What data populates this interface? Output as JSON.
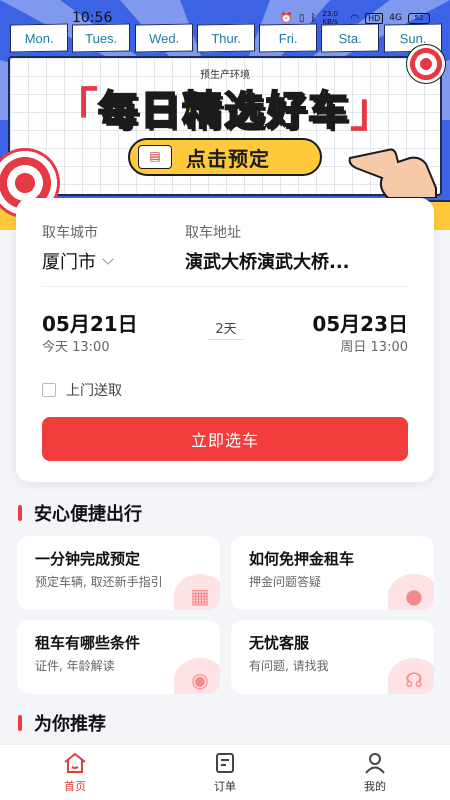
{
  "status_bar": {
    "time": "10:56",
    "network_speed": "23.0 KB/s",
    "hd_badge": "HD",
    "signal": "4G",
    "battery_level": "52"
  },
  "banner": {
    "weekdays": [
      "Mon.",
      "Tues.",
      "Wed.",
      "Thur.",
      "Fri.",
      "Sta.",
      "Sun."
    ],
    "env_label": "预生产环境",
    "headline": "每日精选好车",
    "cta_label": "点击预定",
    "colors": {
      "background": "#3c63e6",
      "headline": "#ffd43b",
      "pill": "#ffc93c",
      "bracket": "#e63946"
    }
  },
  "booking": {
    "city_label": "取车城市",
    "address_label": "取车地址",
    "city_value": "厦门市",
    "address_value": "演武大桥演武大桥...",
    "start_date": "05月21日",
    "start_sub": "今天 13:00",
    "duration": "2天",
    "end_date": "05月23日",
    "end_sub": "周日 13:00",
    "door_delivery_label": "上门送取",
    "submit_label": "立即选车",
    "accent": "#f23d3d"
  },
  "section_convenient": {
    "title": "安心便捷出行",
    "cards": [
      {
        "title": "一分钟完成预定",
        "subtitle": "预定车辆, 取还新手指引",
        "icon": "document-icon"
      },
      {
        "title": "如何免押金租车",
        "subtitle": "押金问题答疑",
        "icon": "money-bag-icon"
      },
      {
        "title": "租车有哪些条件",
        "subtitle": "证件, 年龄解读",
        "icon": "id-card-icon"
      },
      {
        "title": "无忧客服",
        "subtitle": "有问题, 请找我",
        "icon": "headset-icon"
      }
    ]
  },
  "section_recommend": {
    "title": "为你推荐"
  },
  "tabbar": {
    "tabs": [
      {
        "label": "首页",
        "icon": "home-icon",
        "active": true
      },
      {
        "label": "订单",
        "icon": "order-icon",
        "active": false
      },
      {
        "label": "我的",
        "icon": "profile-icon",
        "active": false
      }
    ],
    "active_color": "#e23c3c"
  }
}
